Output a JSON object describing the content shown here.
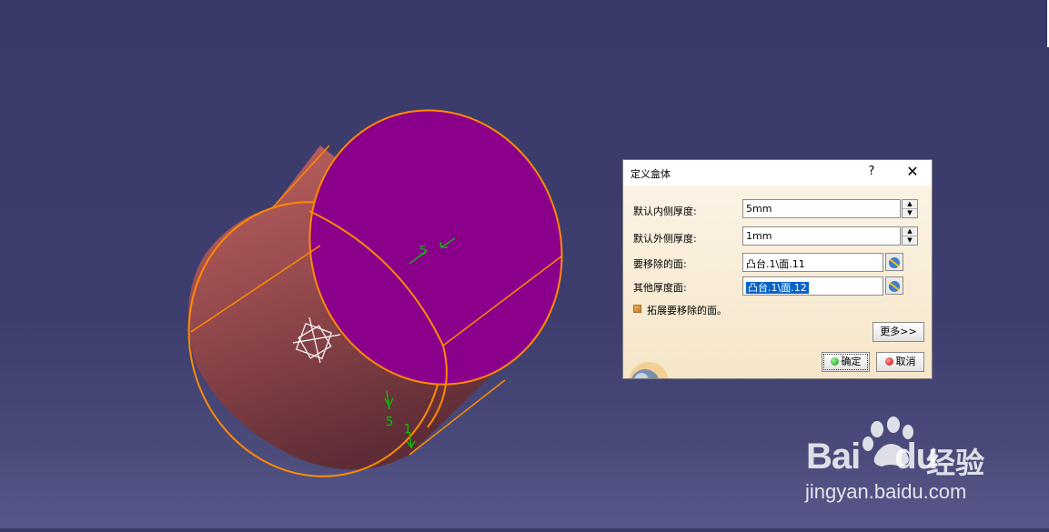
{
  "viewport": {
    "annotation_top": "5",
    "annotation_bottom_a": "5",
    "annotation_bottom_b": "1",
    "colors": {
      "top_face": "#8b008b",
      "side_face": "#b85c5c",
      "edge": "#ff8000",
      "annotation": "#00c000"
    }
  },
  "dialog": {
    "title": "定义盒体",
    "help": "?",
    "close": "✕",
    "fields": [
      {
        "label": "默认内侧厚度:",
        "value": "5mm"
      },
      {
        "label": "默认外侧厚度:",
        "value": "1mm"
      },
      {
        "label": "要移除的面:",
        "value": "凸台.1\\面.11"
      },
      {
        "label": "其他厚度面:",
        "value": "凸台.1\\面.12"
      }
    ],
    "checkbox_label": "拓展要移除的面。",
    "more_button": "更多>>",
    "ok_button": "确定",
    "cancel_button": "取消"
  },
  "watermark": {
    "brand": "Bai",
    "brand2": "du",
    "cn": "经验",
    "url": "jingyan.baidu.com"
  }
}
